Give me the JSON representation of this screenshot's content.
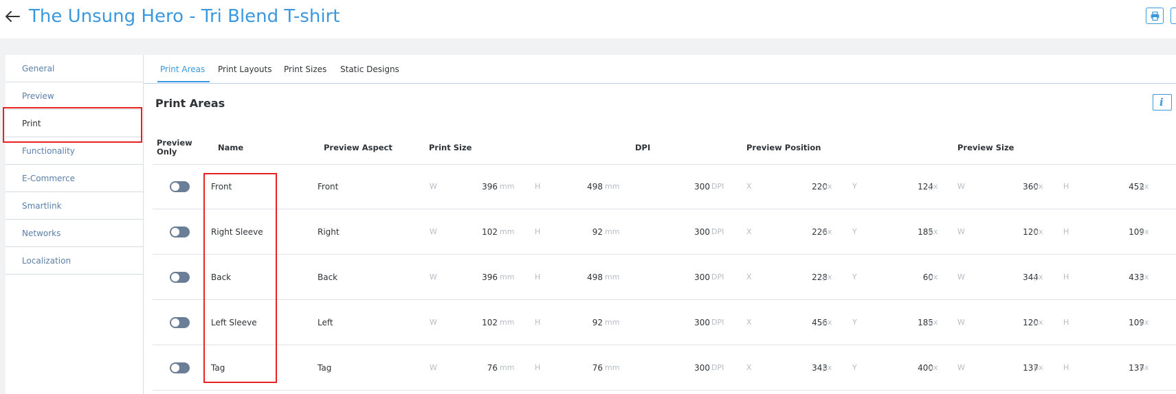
{
  "header": {
    "back_icon": "arrow-left-icon",
    "title": "The Unsung Hero - Tri Blend T-shirt",
    "print_icon": "printer-icon"
  },
  "sidebar": {
    "items": [
      {
        "label": "General"
      },
      {
        "label": "Preview"
      },
      {
        "label": "Print"
      },
      {
        "label": "Functionality"
      },
      {
        "label": "E-Commerce"
      },
      {
        "label": "Smartlink"
      },
      {
        "label": "Networks"
      },
      {
        "label": "Localization"
      }
    ],
    "active": "Print"
  },
  "tabs": [
    {
      "label": "Print Areas"
    },
    {
      "label": "Print Layouts"
    },
    {
      "label": "Print Sizes"
    },
    {
      "label": "Static Designs"
    }
  ],
  "section": {
    "title": "Print Areas",
    "info_icon": "info-icon"
  },
  "table": {
    "headers": {
      "preview_only_1": "Preview",
      "preview_only_2": "Only",
      "name": "Name",
      "preview_aspect": "Preview Aspect",
      "print_size": "Print Size",
      "dpi": "DPI",
      "preview_position": "Preview Position",
      "preview_size": "Preview Size"
    },
    "labels": {
      "w": "W",
      "h": "H",
      "x": "X",
      "y": "Y"
    },
    "units": {
      "mm": "mm",
      "dpi": "DPI",
      "px": "px"
    },
    "rows": [
      {
        "preview_only": false,
        "name": "Front",
        "aspect": "Front",
        "print_w": "396",
        "print_h": "498",
        "dpi": "300",
        "pos_x": "220",
        "pos_y": "124",
        "size_w": "360",
        "size_h": "452"
      },
      {
        "preview_only": false,
        "name": "Right Sleeve",
        "aspect": "Right",
        "print_w": "102",
        "print_h": "92",
        "dpi": "300",
        "pos_x": "226",
        "pos_y": "185",
        "size_w": "120",
        "size_h": "109"
      },
      {
        "preview_only": false,
        "name": "Back",
        "aspect": "Back",
        "print_w": "396",
        "print_h": "498",
        "dpi": "300",
        "pos_x": "228",
        "pos_y": "60",
        "size_w": "344",
        "size_h": "433"
      },
      {
        "preview_only": false,
        "name": "Left Sleeve",
        "aspect": "Left",
        "print_w": "102",
        "print_h": "92",
        "dpi": "300",
        "pos_x": "456",
        "pos_y": "185",
        "size_w": "120",
        "size_h": "109"
      },
      {
        "preview_only": false,
        "name": "Tag",
        "aspect": "Tag",
        "print_w": "76",
        "print_h": "76",
        "dpi": "300",
        "pos_x": "343",
        "pos_y": "400",
        "size_w": "137",
        "size_h": "137"
      }
    ]
  },
  "colors": {
    "accent": "#3a98df",
    "highlight": "#e8201f",
    "toggle_off": "#6b7e97"
  }
}
